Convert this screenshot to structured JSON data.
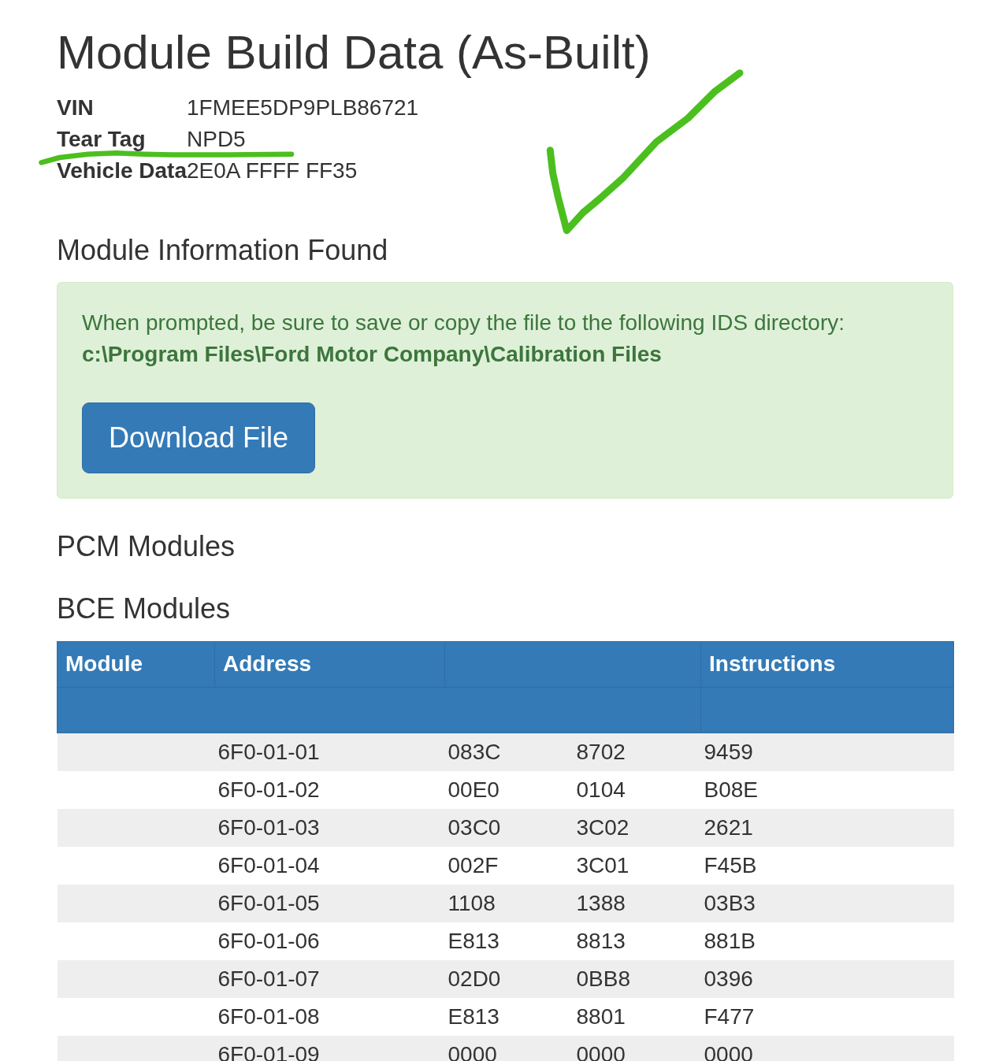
{
  "page": {
    "title": "Module Build Data (As-Built)"
  },
  "vehicle_info": [
    {
      "label": "VIN",
      "value": "1FMEE5DP9PLB86721"
    },
    {
      "label": "Tear Tag",
      "value": "NPD5"
    },
    {
      "label": "Vehicle Data",
      "value": "2E0A FFFF FF35"
    }
  ],
  "module_info": {
    "heading": "Module Information Found",
    "alert": {
      "message": "When prompted, be sure to save or copy the file to the following IDS directory:",
      "path": "c:\\Program Files\\Ford Motor Company\\Calibration Files",
      "button": "Download File"
    }
  },
  "sections": [
    {
      "heading": "PCM Modules"
    },
    {
      "heading": "BCE Modules"
    }
  ],
  "table": {
    "columns": {
      "module": "Module",
      "address": "Address",
      "instructions": "Instructions"
    },
    "rows": [
      {
        "address": "6F0-01-01",
        "column_3": "083C",
        "column_4": "8702",
        "instructions": "9459"
      },
      {
        "address": "6F0-01-02",
        "column_3": "00E0",
        "column_4": "0104",
        "instructions": "B08E"
      },
      {
        "address": "6F0-01-03",
        "column_3": "03C0",
        "column_4": "3C02",
        "instructions": "2621"
      },
      {
        "address": "6F0-01-04",
        "column_3": "002F",
        "column_4": "3C01",
        "instructions": "F45B"
      },
      {
        "address": "6F0-01-05",
        "column_3": "1108",
        "column_4": "1388",
        "instructions": "03B3"
      },
      {
        "address": "6F0-01-06",
        "column_3": "E813",
        "column_4": "8813",
        "instructions": "881B"
      },
      {
        "address": "6F0-01-07",
        "column_3": "02D0",
        "column_4": "0BB8",
        "instructions": "0396"
      },
      {
        "address": "6F0-01-08",
        "column_3": "E813",
        "column_4": "8801",
        "instructions": "F477"
      },
      {
        "address": "6F0-01-09",
        "column_3": "0000",
        "column_4": "0000",
        "instructions": "0000"
      }
    ]
  }
}
